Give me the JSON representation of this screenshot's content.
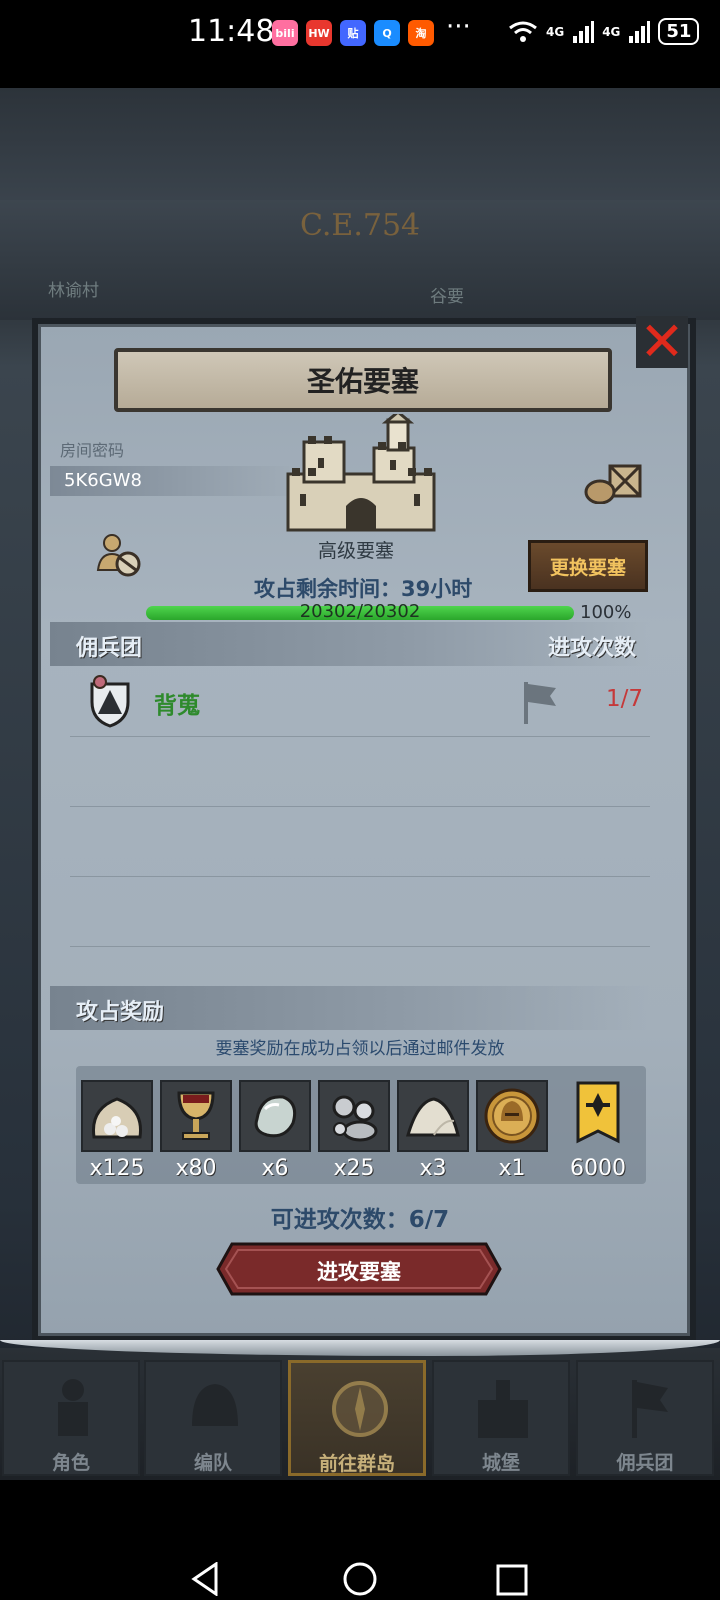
{
  "status_bar": {
    "time": "11:48",
    "apps": [
      {
        "name": "bilibili-icon",
        "color": "#ff6fa0",
        "label": "bili"
      },
      {
        "name": "huawei-store-icon",
        "color": "#e8372e",
        "label": "HW"
      },
      {
        "name": "tieba-icon",
        "color": "#4267ff",
        "label": "贴"
      },
      {
        "name": "qq-icon",
        "color": "#1a8cff",
        "label": "Q"
      },
      {
        "name": "taobao-icon",
        "color": "#ff5a00",
        "label": "淘"
      }
    ],
    "more": "···",
    "signal1": "4G",
    "signal2": "4G",
    "battery": "51"
  },
  "background": {
    "era": "C.E.754",
    "village": "林谕村",
    "valley": "谷要"
  },
  "panel": {
    "title": "圣佑要塞",
    "room_label": "房间密码",
    "room_code": "5K6GW8",
    "fort_type": "高级要塞",
    "swap_button": "更换要塞",
    "time_left_label": "攻占剩余时间：",
    "time_left_value": "39小时",
    "hp_text": "20302/20302",
    "hp_percent": "100%",
    "hp_fraction": 1.0,
    "mercenary_header": "佣兵团",
    "attacks_header": "进攻次数",
    "mercenaries": [
      {
        "name": "背蒐",
        "attacks": "1/7"
      }
    ],
    "rewards_header": "攻占奖励",
    "reward_note": "要塞奖励在成功占领以后通过邮件发放",
    "rewards": [
      {
        "icon": "ore-sack-icon",
        "qty": "x125"
      },
      {
        "icon": "goblet-icon",
        "qty": "x80"
      },
      {
        "icon": "moonstone-icon",
        "qty": "x6"
      },
      {
        "icon": "silver-nuggets-icon",
        "qty": "x25"
      },
      {
        "icon": "salt-pile-icon",
        "qty": "x3"
      },
      {
        "icon": "helmet-coin-icon",
        "qty": "x1"
      },
      {
        "icon": "guild-banner-icon",
        "qty": "6000"
      }
    ],
    "attack_left_label": "可进攻次数：",
    "attack_left_value": "6/7",
    "attack_button": "进攻要塞"
  },
  "game_nav": [
    {
      "label": "角色",
      "icon": "knight-icon",
      "active": false
    },
    {
      "label": "编队",
      "icon": "helmet-icon",
      "active": false
    },
    {
      "label": "前往群岛",
      "icon": "compass-icon",
      "active": true
    },
    {
      "label": "城堡",
      "icon": "castle-icon",
      "active": false
    },
    {
      "label": "佣兵团",
      "icon": "banner-icon",
      "active": false
    }
  ],
  "colors": {
    "accent_gold": "#f2c35f",
    "hp_green": "#3cc23a",
    "merc_green": "#2e8a2c",
    "attack_red": "#c5393a",
    "attack_button": "#7a2a2a"
  }
}
